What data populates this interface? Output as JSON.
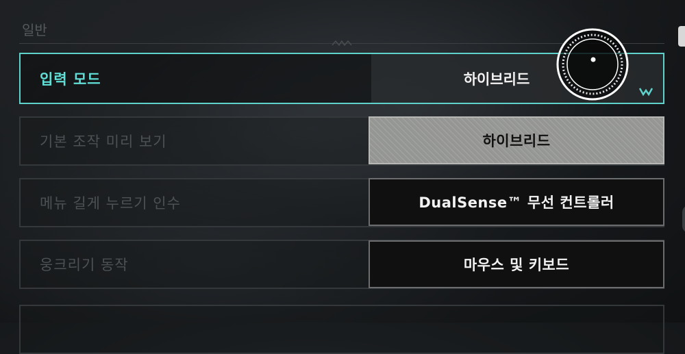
{
  "section": {
    "title": "일반"
  },
  "rows": [
    {
      "label": "입력 모드",
      "value": "하이브리드"
    },
    {
      "label": "기본 조작 미리 보기",
      "value": ""
    },
    {
      "label": "메뉴 길게 누르기 인수",
      "value": ""
    },
    {
      "label": "웅크리기 동작",
      "value": ""
    },
    {
      "label": "",
      "value": ""
    }
  ],
  "dropdown": {
    "options": [
      "하이브리드",
      "DualSense™ 무선 컨트롤러",
      "마우스 및 키보드"
    ],
    "highlighted_index": 0
  },
  "colors": {
    "accent": "#5fd2cb",
    "highlight": "#9c9d9a",
    "option_bg": "#101010"
  }
}
